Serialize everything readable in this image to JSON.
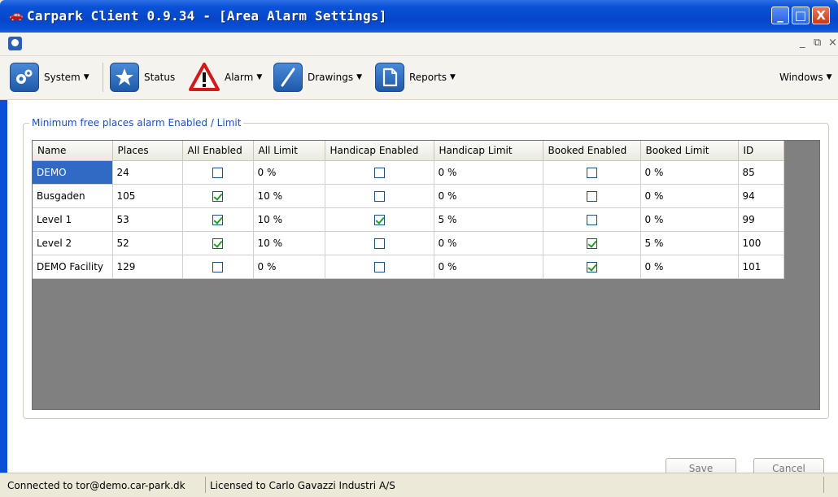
{
  "window": {
    "title": "Carpark Client 0.9.34 - [Area Alarm Settings]",
    "minimize_glyph": "_",
    "maximize_glyph": "□",
    "close_glyph": "X"
  },
  "mdi": {
    "minimize": "_",
    "restore": "⧉",
    "close": "×"
  },
  "toolbar": {
    "system": "System",
    "status": "Status",
    "alarm": "Alarm",
    "drawings": "Drawings",
    "reports": "Reports",
    "windows": "Windows"
  },
  "group_label": "Minimum free places alarm Enabled / Limit",
  "table": {
    "headers": [
      "Name",
      "Places",
      "All Enabled",
      "All Limit",
      "Handicap Enabled",
      "Handicap Limit",
      "Booked Enabled",
      "Booked Limit",
      "ID"
    ],
    "rows": [
      {
        "name": "DEMO",
        "places": "24",
        "all_enabled": false,
        "all_limit": "0 %",
        "handicap_enabled": false,
        "handicap_limit": "0 %",
        "booked_enabled": false,
        "booked_limit": "0 %",
        "id": "85"
      },
      {
        "name": "Busgaden",
        "places": "105",
        "all_enabled": true,
        "all_limit": "10 %",
        "handicap_enabled": false,
        "handicap_limit": "0 %",
        "booked_enabled": false,
        "booked_limit": "0 %",
        "id": "94"
      },
      {
        "name": "Level 1",
        "places": "53",
        "all_enabled": true,
        "all_limit": "10 %",
        "handicap_enabled": true,
        "handicap_limit": "5 %",
        "booked_enabled": false,
        "booked_limit": "0 %",
        "id": "99"
      },
      {
        "name": "Level 2",
        "places": "52",
        "all_enabled": true,
        "all_limit": "10 %",
        "handicap_enabled": false,
        "handicap_limit": "0 %",
        "booked_enabled": true,
        "booked_limit": "5 %",
        "id": "100"
      },
      {
        "name": "DEMO Facility",
        "places": "129",
        "all_enabled": false,
        "all_limit": "0 %",
        "handicap_enabled": false,
        "handicap_limit": "0 %",
        "booked_enabled": true,
        "booked_limit": "0 %",
        "id": "101"
      }
    ]
  },
  "buttons": {
    "save": "Save",
    "cancel": "Cancel"
  },
  "status": {
    "connected": "Connected to tor@demo.car-park.dk",
    "licensed": "Licensed to Carlo Gavazzi Industri A/S"
  },
  "colors": {
    "titlebar": "#0546c8",
    "selection": "#316ac5",
    "check": "#21a121",
    "legend_text": "#1a4fb8",
    "grid_empty": "#808080"
  }
}
